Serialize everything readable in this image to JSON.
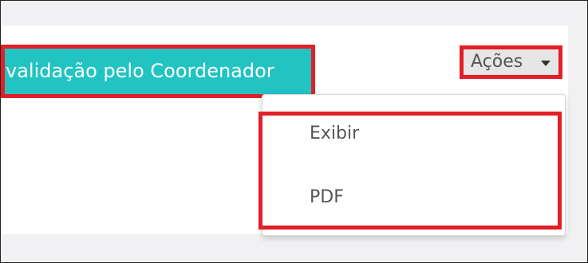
{
  "status": {
    "label": "validação pelo Coordenador"
  },
  "actions": {
    "label": "Ações",
    "menu": [
      {
        "label": "Exibir"
      },
      {
        "label": "PDF"
      }
    ]
  },
  "colors": {
    "status_button": "#22c3c3",
    "highlight": "#e21f26",
    "actions_bg": "#e6e6e6",
    "page_bg": "#f1f1f3"
  },
  "icons": {
    "actions_caret": "caret-down-icon"
  }
}
